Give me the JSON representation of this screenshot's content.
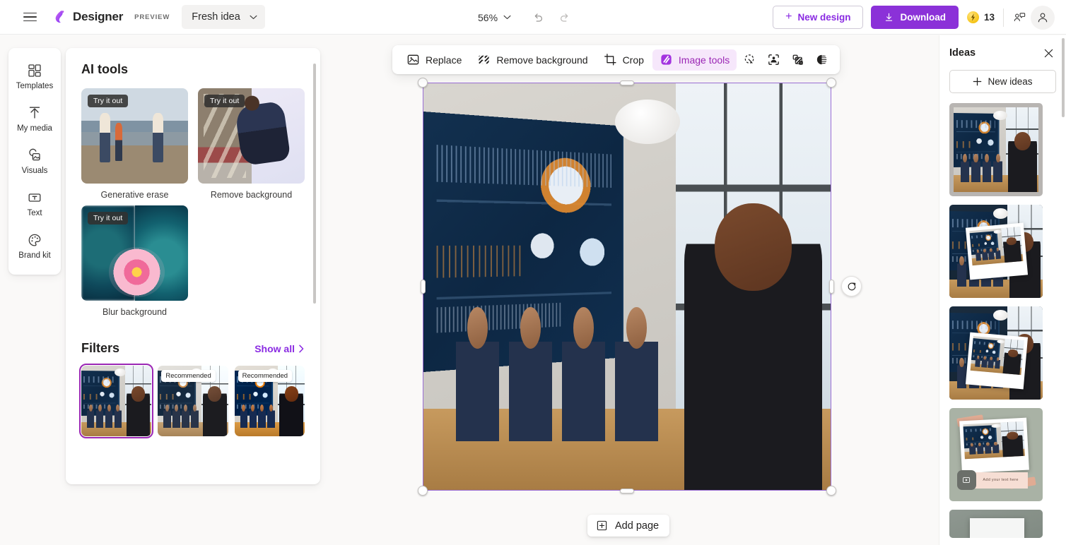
{
  "header": {
    "menu_icon": "hamburger-icon",
    "brand": "Designer",
    "preview_tag": "PREVIEW",
    "doc_name": "Fresh idea",
    "zoom_level": "56%",
    "undo_icon": "undo-icon",
    "redo_icon": "redo-icon",
    "new_design_label": "New design",
    "download_label": "Download",
    "credits": "13",
    "credits_icon": "coin-bolt-icon",
    "share_icon": "share-people-icon",
    "account_icon": "account-avatar-icon"
  },
  "rail": {
    "items": [
      {
        "label": "Templates",
        "icon": "templates-grid-icon"
      },
      {
        "label": "My media",
        "icon": "upload-arrow-icon"
      },
      {
        "label": "Visuals",
        "icon": "visuals-image-icon"
      },
      {
        "label": "Text",
        "icon": "text-box-icon"
      },
      {
        "label": "Brand kit",
        "icon": "palette-icon"
      }
    ]
  },
  "panel": {
    "title": "AI tools",
    "try_chip": "Try it out",
    "tools": [
      {
        "label": "Generative erase"
      },
      {
        "label": "Remove background"
      },
      {
        "label": "Blur background"
      }
    ],
    "filters_title": "Filters",
    "show_all": "Show all",
    "show_all_icon": "chevron-right-icon",
    "filters": [
      {
        "badge": "",
        "selected": true
      },
      {
        "badge": "Recommended",
        "selected": false
      },
      {
        "badge": "Recommended",
        "selected": false
      }
    ]
  },
  "toolbar": {
    "items": [
      {
        "label": "Replace",
        "icon": "replace-image-icon",
        "active": false
      },
      {
        "label": "Remove background",
        "icon": "remove-background-icon",
        "active": false
      },
      {
        "label": "Crop",
        "icon": "crop-icon",
        "active": false
      },
      {
        "label": "Image tools",
        "icon": "image-tools-sparkle-icon",
        "active": true
      }
    ],
    "icon_items": [
      {
        "icon": "magic-select-icon"
      },
      {
        "icon": "fit-image-frame-icon"
      },
      {
        "icon": "layers-transparency-icon"
      },
      {
        "icon": "contrast-icon"
      }
    ]
  },
  "canvas": {
    "rotate_icon": "rotate-icon",
    "add_page_label": "Add page",
    "add_page_icon": "plus-box-icon",
    "selection_color": "#9b6fd6"
  },
  "ideas": {
    "title": "Ideas",
    "close_icon": "close-icon",
    "new_ideas_label": "New ideas",
    "cards": [
      {
        "type": "plain",
        "note": ""
      },
      {
        "type": "frame",
        "note": ""
      },
      {
        "type": "frame",
        "note": ""
      },
      {
        "type": "frame-note",
        "note": "Add your text here"
      },
      {
        "type": "partial",
        "note": ""
      }
    ]
  },
  "colors": {
    "accent": "#8b31d8",
    "accent_text": "#8a2be2",
    "active_chip_bg": "#f6e7fb",
    "selection": "#9b6fd6",
    "coin": "#f6c518"
  }
}
